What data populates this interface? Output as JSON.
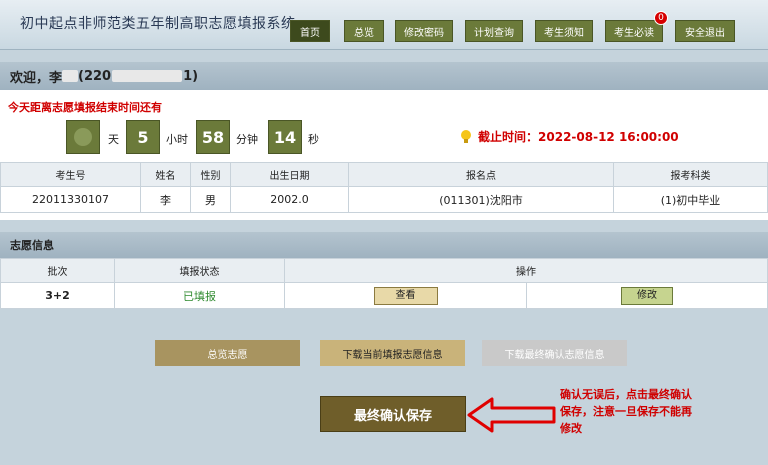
{
  "header": {
    "title": "初中起点非师范类五年制高职志愿填报系统",
    "nav": [
      {
        "label": "首页",
        "active": true
      },
      {
        "label": "总览"
      },
      {
        "label": "修改密码"
      },
      {
        "label": "计划查询"
      },
      {
        "label": "考生须知"
      },
      {
        "label": "考生必读",
        "badge": "0"
      },
      {
        "label": "安全退出"
      }
    ]
  },
  "welcome": {
    "prefix": "欢迎，李",
    "id_open": "(220",
    "id_close": "1)"
  },
  "countdown": {
    "label": "今天距离志愿填报结束时间还有",
    "days": "",
    "days_unit": "天",
    "hours": "5",
    "hours_unit": "小时",
    "minutes": "58",
    "minutes_unit": "分钟",
    "seconds": "14",
    "seconds_unit": "秒",
    "deadline_label": "截止时间：",
    "deadline_value": "2022-08-12 16:00:00"
  },
  "student_table": {
    "headers": [
      "考生号",
      "姓名",
      "性别",
      "出生日期",
      "报名点",
      "报考科类"
    ],
    "row": [
      "22011330107",
      "李",
      "男",
      "2002.0",
      "(011301)沈阳市",
      "(1)初中毕业"
    ]
  },
  "volunteer": {
    "section_title": "志愿信息",
    "headers": [
      "批次",
      "填报状态",
      "操作"
    ],
    "row": {
      "batch": "3+2",
      "status": "已填报",
      "view": "查看",
      "edit": "修改"
    }
  },
  "actions": {
    "overview": "总览志愿",
    "download_current": "下载当前填报志愿信息",
    "download_final": "下载最终确认志愿信息",
    "final_confirm": "最终确认保存"
  },
  "note": "确认无误后，点击最终确认保存，注意一旦保存不能再修改",
  "colors": {
    "nav_bg": "#6b7a3a",
    "accent_red": "#d00000",
    "final_btn": "#6f5e2a"
  }
}
